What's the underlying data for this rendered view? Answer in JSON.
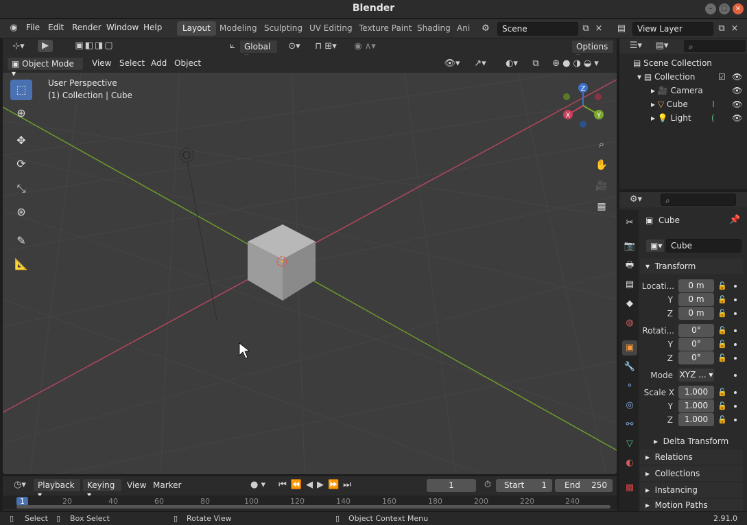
{
  "window": {
    "title": "Blender"
  },
  "menu": [
    "File",
    "Edit",
    "Render",
    "Window",
    "Help"
  ],
  "workspaces": [
    "Layout",
    "Modeling",
    "Sculpting",
    "UV Editing",
    "Texture Paint",
    "Shading",
    "Ani"
  ],
  "scene": {
    "name": "Scene"
  },
  "view_layer": {
    "name": "View Layer"
  },
  "viewport": {
    "orientation": "Global",
    "options": "Options",
    "mode": "Object Mode",
    "menus": [
      "View",
      "Select",
      "Add",
      "Object"
    ],
    "info_line1": "User Perspective",
    "info_line2": "(1) Collection | Cube",
    "gizmo": {
      "x": "X",
      "y": "Y",
      "z": "Z"
    }
  },
  "outliner": {
    "root": "Scene Collection",
    "collection": "Collection",
    "items": [
      "Camera",
      "Cube",
      "Light"
    ]
  },
  "properties": {
    "object_name": "Cube",
    "data_name": "Cube",
    "transform_title": "Transform",
    "location_label": "Locati...",
    "location": [
      "0 m",
      "0 m",
      "0 m"
    ],
    "rotation_label": "Rotati...",
    "rotation": [
      "0°",
      "0°",
      "0°"
    ],
    "mode_label": "Mode",
    "mode_value": "XYZ ...",
    "scale_label": "Scale X",
    "scale": [
      "1.000",
      "1.000",
      "1.000"
    ],
    "axis_y": "Y",
    "axis_z": "Z",
    "delta": "Delta Transform",
    "panels": [
      "Relations",
      "Collections",
      "Instancing",
      "Motion Paths"
    ]
  },
  "timeline": {
    "menus": [
      "Playback",
      "Keying",
      "View",
      "Marker"
    ],
    "current_frame": "1",
    "start_label": "Start",
    "start": "1",
    "end_label": "End",
    "end": "250",
    "ruler": [
      "1",
      "20",
      "40",
      "60",
      "80",
      "100",
      "120",
      "140",
      "160",
      "180",
      "200",
      "220",
      "240"
    ]
  },
  "status": {
    "items": [
      "Select",
      "Box Select",
      "Rotate View",
      "Object Context Menu"
    ],
    "version": "2.91.0"
  },
  "colors": {
    "accent": "#4a72b3",
    "x_axis": "#c8415d",
    "y_axis": "#7da82f",
    "z_axis": "#3d72c8"
  }
}
